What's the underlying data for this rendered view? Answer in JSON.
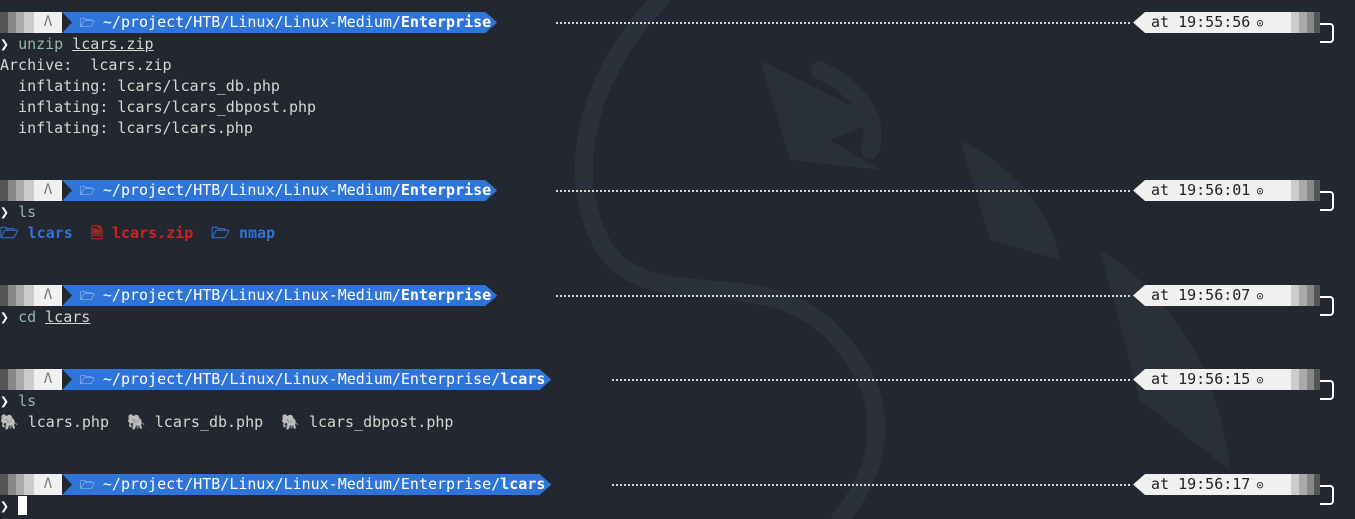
{
  "prompts": [
    {
      "path_prefix": "~/project/HTB/Linux/Linux-Medium/",
      "path_bold": "Enterprise",
      "time": "at 19:55:56"
    },
    {
      "path_prefix": "~/project/HTB/Linux/Linux-Medium/",
      "path_bold": "Enterprise",
      "time": "at 19:56:01"
    },
    {
      "path_prefix": "~/project/HTB/Linux/Linux-Medium/",
      "path_bold": "Enterprise",
      "time": "at 19:56:07"
    },
    {
      "path_prefix": "~/project/HTB/Linux/Linux-Medium/Enterprise/",
      "path_bold": "lcars",
      "time": "at 19:56:15"
    },
    {
      "path_prefix": "~/project/HTB/Linux/Linux-Medium/Enterprise/",
      "path_bold": "lcars",
      "time": "at 19:56:17"
    }
  ],
  "commands": [
    {
      "prompt_char": "❯",
      "cmd": "unzip",
      "arg": "lcars.zip"
    },
    {
      "prompt_char": "❯",
      "cmd": "ls",
      "arg": ""
    },
    {
      "prompt_char": "❯",
      "cmd": "cd",
      "arg": "lcars"
    },
    {
      "prompt_char": "❯",
      "cmd": "ls",
      "arg": ""
    },
    {
      "prompt_char": "❯",
      "cmd": "",
      "arg": ""
    }
  ],
  "unzip_output": [
    "Archive:  lcars.zip",
    "  inflating: lcars/lcars_db.php",
    "  inflating: lcars/lcars_dbpost.php",
    "  inflating: lcars/lcars.php"
  ],
  "ls1": {
    "dir1": "lcars",
    "zip": "lcars.zip",
    "dir2": "nmap"
  },
  "ls2": {
    "f1": "lcars.php",
    "f2": "lcars_db.php",
    "f3": "lcars_dbpost.php"
  },
  "icons": {
    "arch": "arch-linux-icon",
    "folder": "folder-open-icon",
    "clock": "clock-icon",
    "php": "php-elephant-icon",
    "archive": "zip-archive-icon"
  },
  "colors": {
    "background": "#222730",
    "path_segment": "#2f74d8",
    "directory": "#2f74d8",
    "archive": "#cc2222"
  }
}
